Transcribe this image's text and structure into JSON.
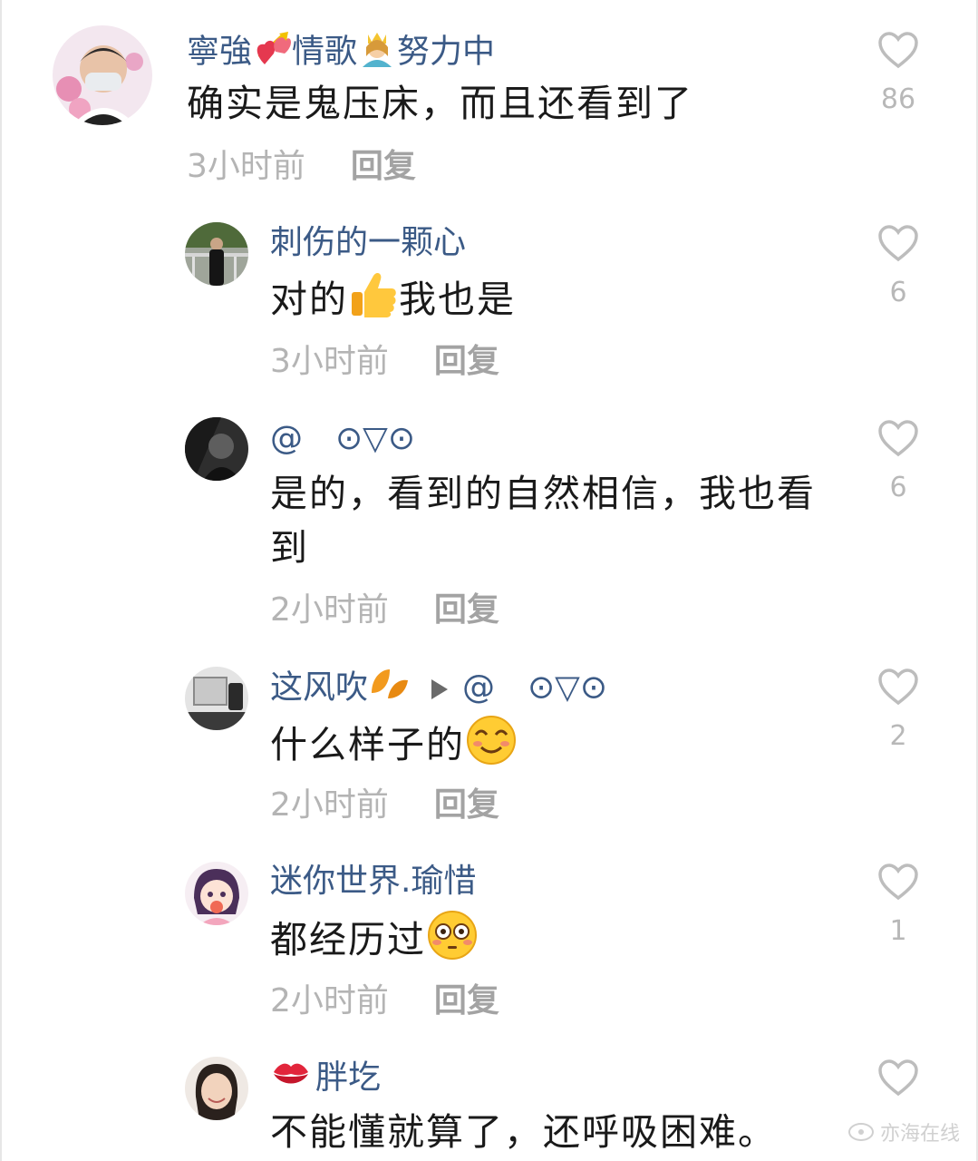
{
  "comments": [
    {
      "name_parts": [
        "寧強",
        "情歌",
        "努力中"
      ],
      "text": "确实是鬼压床，而且还看到了",
      "time": "3小时前",
      "reply_label": "回复",
      "likes": "86"
    },
    {
      "name": "刺伤的一颗心",
      "text_before": "对的",
      "text_after": "我也是",
      "time": "3小时前",
      "reply_label": "回复",
      "likes": "6"
    },
    {
      "name": "@　⊙▽⊙",
      "text": "是的，看到的自然相信，我也看到",
      "time": "2小时前",
      "reply_label": "回复",
      "likes": "6"
    },
    {
      "name_before": "这风吹",
      "name_after": "@　⊙▽⊙",
      "text": "什么样子的",
      "time": "2小时前",
      "reply_label": "回复",
      "likes": "2"
    },
    {
      "name": "迷你世界.瑜惜",
      "text": "都经历过",
      "time": "2小时前",
      "reply_label": "回复",
      "likes": "1"
    },
    {
      "name": "胖圪",
      "text": "不能懂就算了，还呼吸困难。"
    }
  ],
  "watermark": "亦海在线"
}
